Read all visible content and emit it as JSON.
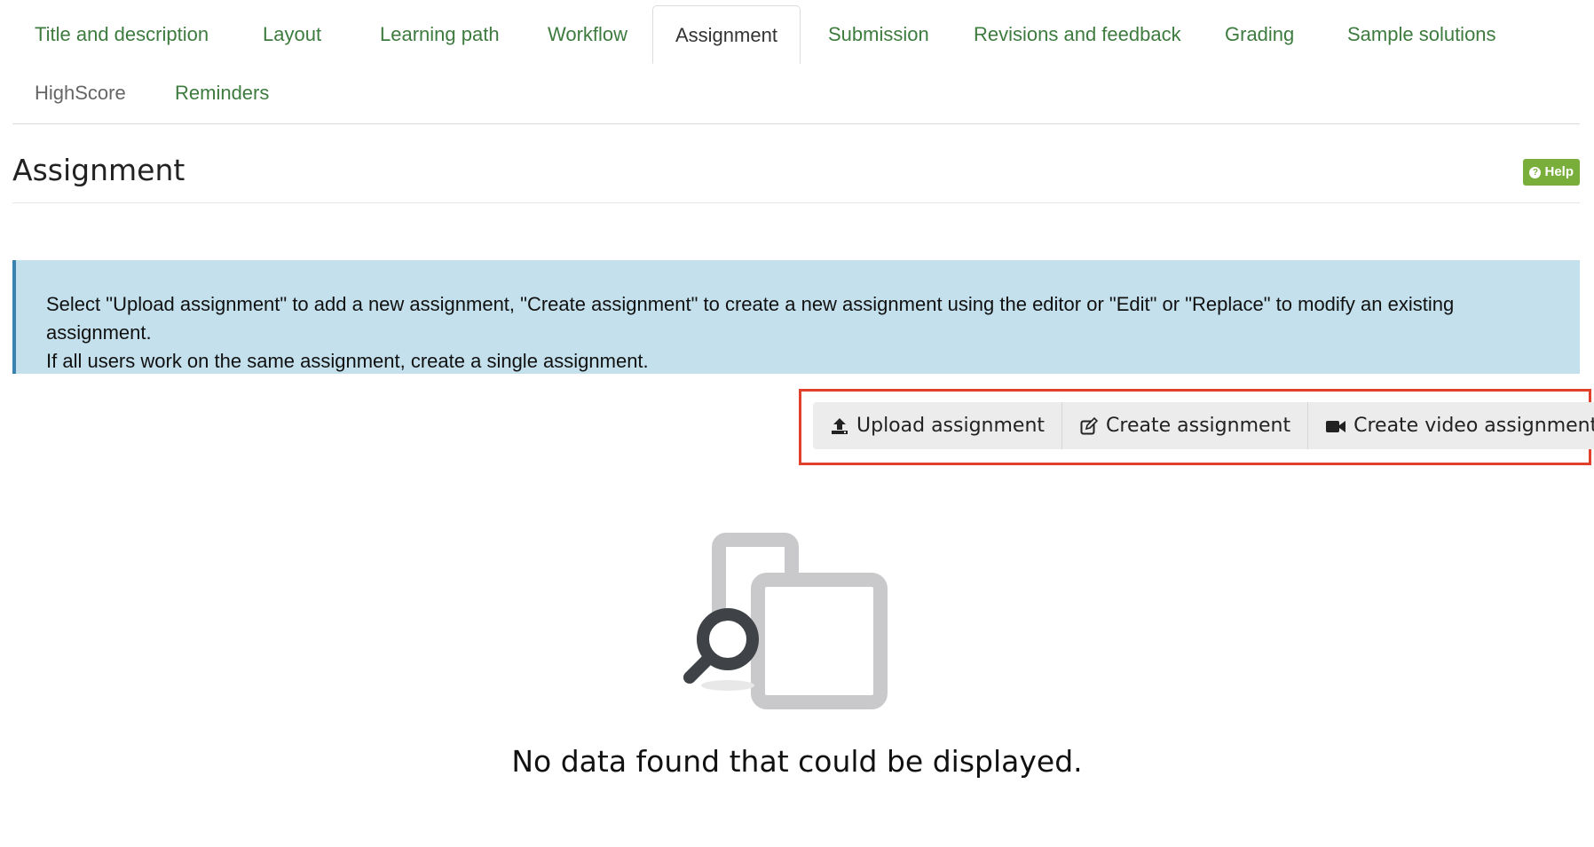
{
  "tabs": [
    {
      "label": "Title and description"
    },
    {
      "label": "Layout"
    },
    {
      "label": "Learning path"
    },
    {
      "label": "Workflow"
    },
    {
      "label": "Assignment"
    },
    {
      "label": "Submission"
    },
    {
      "label": "Revisions and feedback"
    },
    {
      "label": "Grading"
    },
    {
      "label": "Sample solutions"
    },
    {
      "label": "HighScore"
    },
    {
      "label": "Reminders"
    }
  ],
  "active_tab": "Assignment",
  "page": {
    "title": "Assignment",
    "help_label": "Help"
  },
  "info": {
    "line1": "Select \"Upload assignment\" to add a new assignment, \"Create assignment\" to create a new assignment using the editor or \"Edit\" or \"Replace\" to modify an existing assignment.",
    "line2": "If all users work on the same assignment, create a single assignment."
  },
  "actions": {
    "upload_label": "Upload assignment",
    "upload_icon": "upload-icon",
    "create_label": "Create assignment",
    "create_icon": "edit-icon",
    "video_label": "Create video assignment",
    "video_icon": "video-camera-icon"
  },
  "empty_state": {
    "message": "No data found that could be displayed."
  },
  "colors": {
    "tab_link": "#3d7b3e",
    "info_bg": "#c3e0ec",
    "help_bg": "#7aae3a",
    "highlight": "#e0402c"
  }
}
